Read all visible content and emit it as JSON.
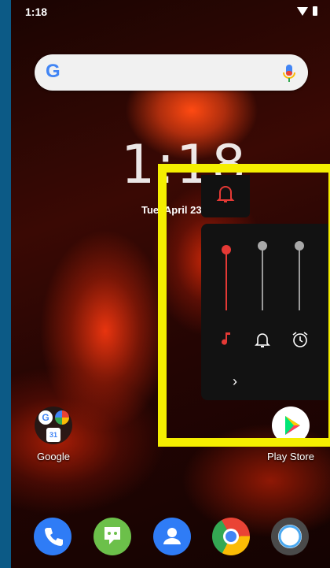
{
  "status": {
    "time": "1:18",
    "icons": [
      "wifi-icon",
      "battery-icon"
    ]
  },
  "search": {
    "logo_letter": "G",
    "mic_icon": "mic-icon"
  },
  "clock": {
    "time": "1:18",
    "date": "Tue, April 23"
  },
  "apps": {
    "google_folder": {
      "label": "Google",
      "mini_icons": [
        "google-g-icon",
        "photos-icon",
        "calendar-icon"
      ],
      "calendar_day": "31"
    },
    "play_store": {
      "label": "Play Store"
    }
  },
  "dock": [
    "phone-icon",
    "hangouts-icon",
    "contacts-icon",
    "chrome-icon",
    "assistant-icon"
  ],
  "volume_panel": {
    "ringer_icon": "bell-icon",
    "sliders": [
      {
        "name": "media",
        "icon": "music-note-icon",
        "level": 1.0,
        "active": true
      },
      {
        "name": "ring",
        "icon": "bell-icon",
        "level": 1.0,
        "active": false
      },
      {
        "name": "alarm",
        "icon": "alarm-icon",
        "level": 1.0,
        "active": false
      }
    ],
    "expand_glyph": "›"
  },
  "colors": {
    "accent": "#e53935",
    "highlight": "#f5ee00",
    "panel": "#121212"
  }
}
